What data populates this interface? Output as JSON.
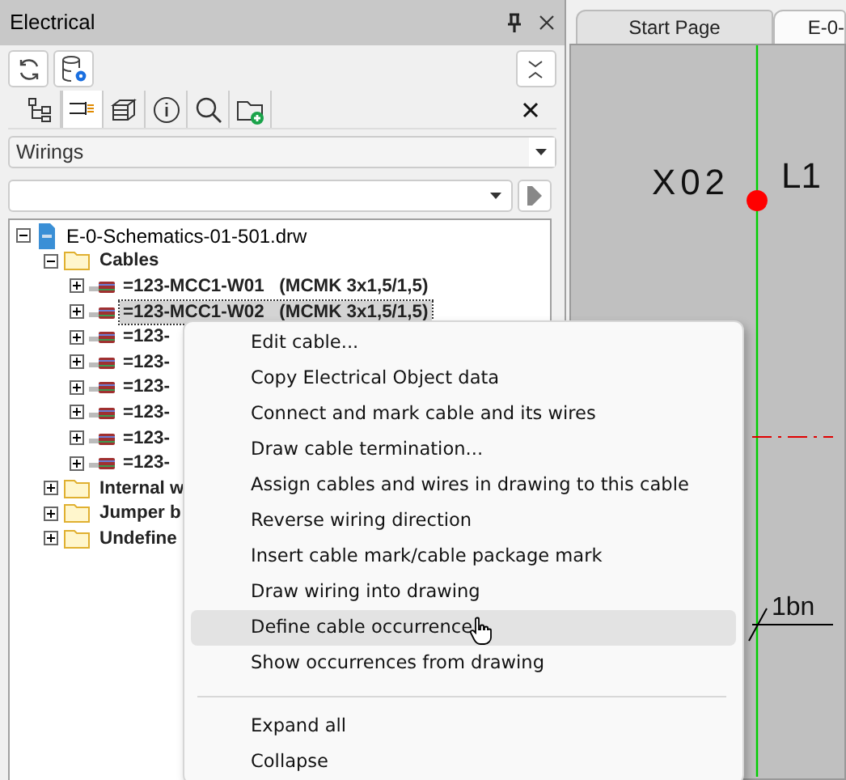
{
  "panel": {
    "title": "Electrical"
  },
  "view_tabs": [
    {
      "selected": false
    },
    {
      "selected": true
    },
    {
      "selected": false
    },
    {
      "selected": false
    },
    {
      "selected": false
    },
    {
      "selected": false
    }
  ],
  "type_select": {
    "value": "Wirings"
  },
  "tree": [
    {
      "label": "E-0-Schematics-01-501.drw",
      "kind": "file",
      "expanded": true,
      "selected": false,
      "children": [
        {
          "label": "Cables",
          "kind": "folder",
          "expanded": true,
          "selected": false,
          "children": [
            {
              "label": "=123-MCC1-W01   (MCMK 3x1,5/1,5)",
              "kind": "cable",
              "expanded": false,
              "selected": false
            },
            {
              "label": "=123-MCC1-W02   (MCMK 3x1,5/1,5)",
              "kind": "cable",
              "expanded": false,
              "selected": true
            },
            {
              "label": "=123-",
              "kind": "cable",
              "expanded": false,
              "selected": false
            },
            {
              "label": "=123-",
              "kind": "cable",
              "expanded": false,
              "selected": false
            },
            {
              "label": "=123-",
              "kind": "cable",
              "expanded": false,
              "selected": false
            },
            {
              "label": "=123-",
              "kind": "cable",
              "expanded": false,
              "selected": false
            },
            {
              "label": "=123-",
              "kind": "cable",
              "expanded": false,
              "selected": false
            },
            {
              "label": "=123-",
              "kind": "cable",
              "expanded": false,
              "selected": false
            }
          ]
        },
        {
          "label": "Internal w",
          "kind": "folder",
          "expanded": false,
          "selected": false
        },
        {
          "label": "Jumper b",
          "kind": "folder",
          "expanded": false,
          "selected": false
        },
        {
          "label": "Undefine",
          "kind": "folder",
          "expanded": false,
          "selected": false
        }
      ]
    }
  ],
  "document_tabs": [
    {
      "label": "Start Page",
      "selected": false
    },
    {
      "label": "E-0-",
      "selected": true
    }
  ],
  "drawing": {
    "labels": [
      "X02",
      "L1",
      "1bn"
    ]
  },
  "context_menu": [
    {
      "kind": "item",
      "label": "Edit cable...",
      "hovered": false
    },
    {
      "kind": "item",
      "label": "Copy Electrical Object data",
      "hovered": false
    },
    {
      "kind": "item",
      "label": "Connect and mark cable and its wires",
      "hovered": false
    },
    {
      "kind": "item",
      "label": "Draw cable termination...",
      "hovered": false
    },
    {
      "kind": "item",
      "label": "Assign cables and wires in drawing to this cable",
      "hovered": false
    },
    {
      "kind": "item",
      "label": "Reverse wiring direction",
      "hovered": false
    },
    {
      "kind": "item",
      "label": "Insert cable mark/cable package mark",
      "hovered": false
    },
    {
      "kind": "item",
      "label": "Draw wiring into drawing",
      "hovered": false
    },
    {
      "kind": "item",
      "label": "Define cable occurrence",
      "hovered": true
    },
    {
      "kind": "item",
      "label": "Show occurrences from drawing",
      "hovered": false
    },
    {
      "kind": "separator"
    },
    {
      "kind": "item",
      "label": "Expand all",
      "hovered": false
    },
    {
      "kind": "item",
      "label": "Collapse",
      "hovered": false
    }
  ]
}
